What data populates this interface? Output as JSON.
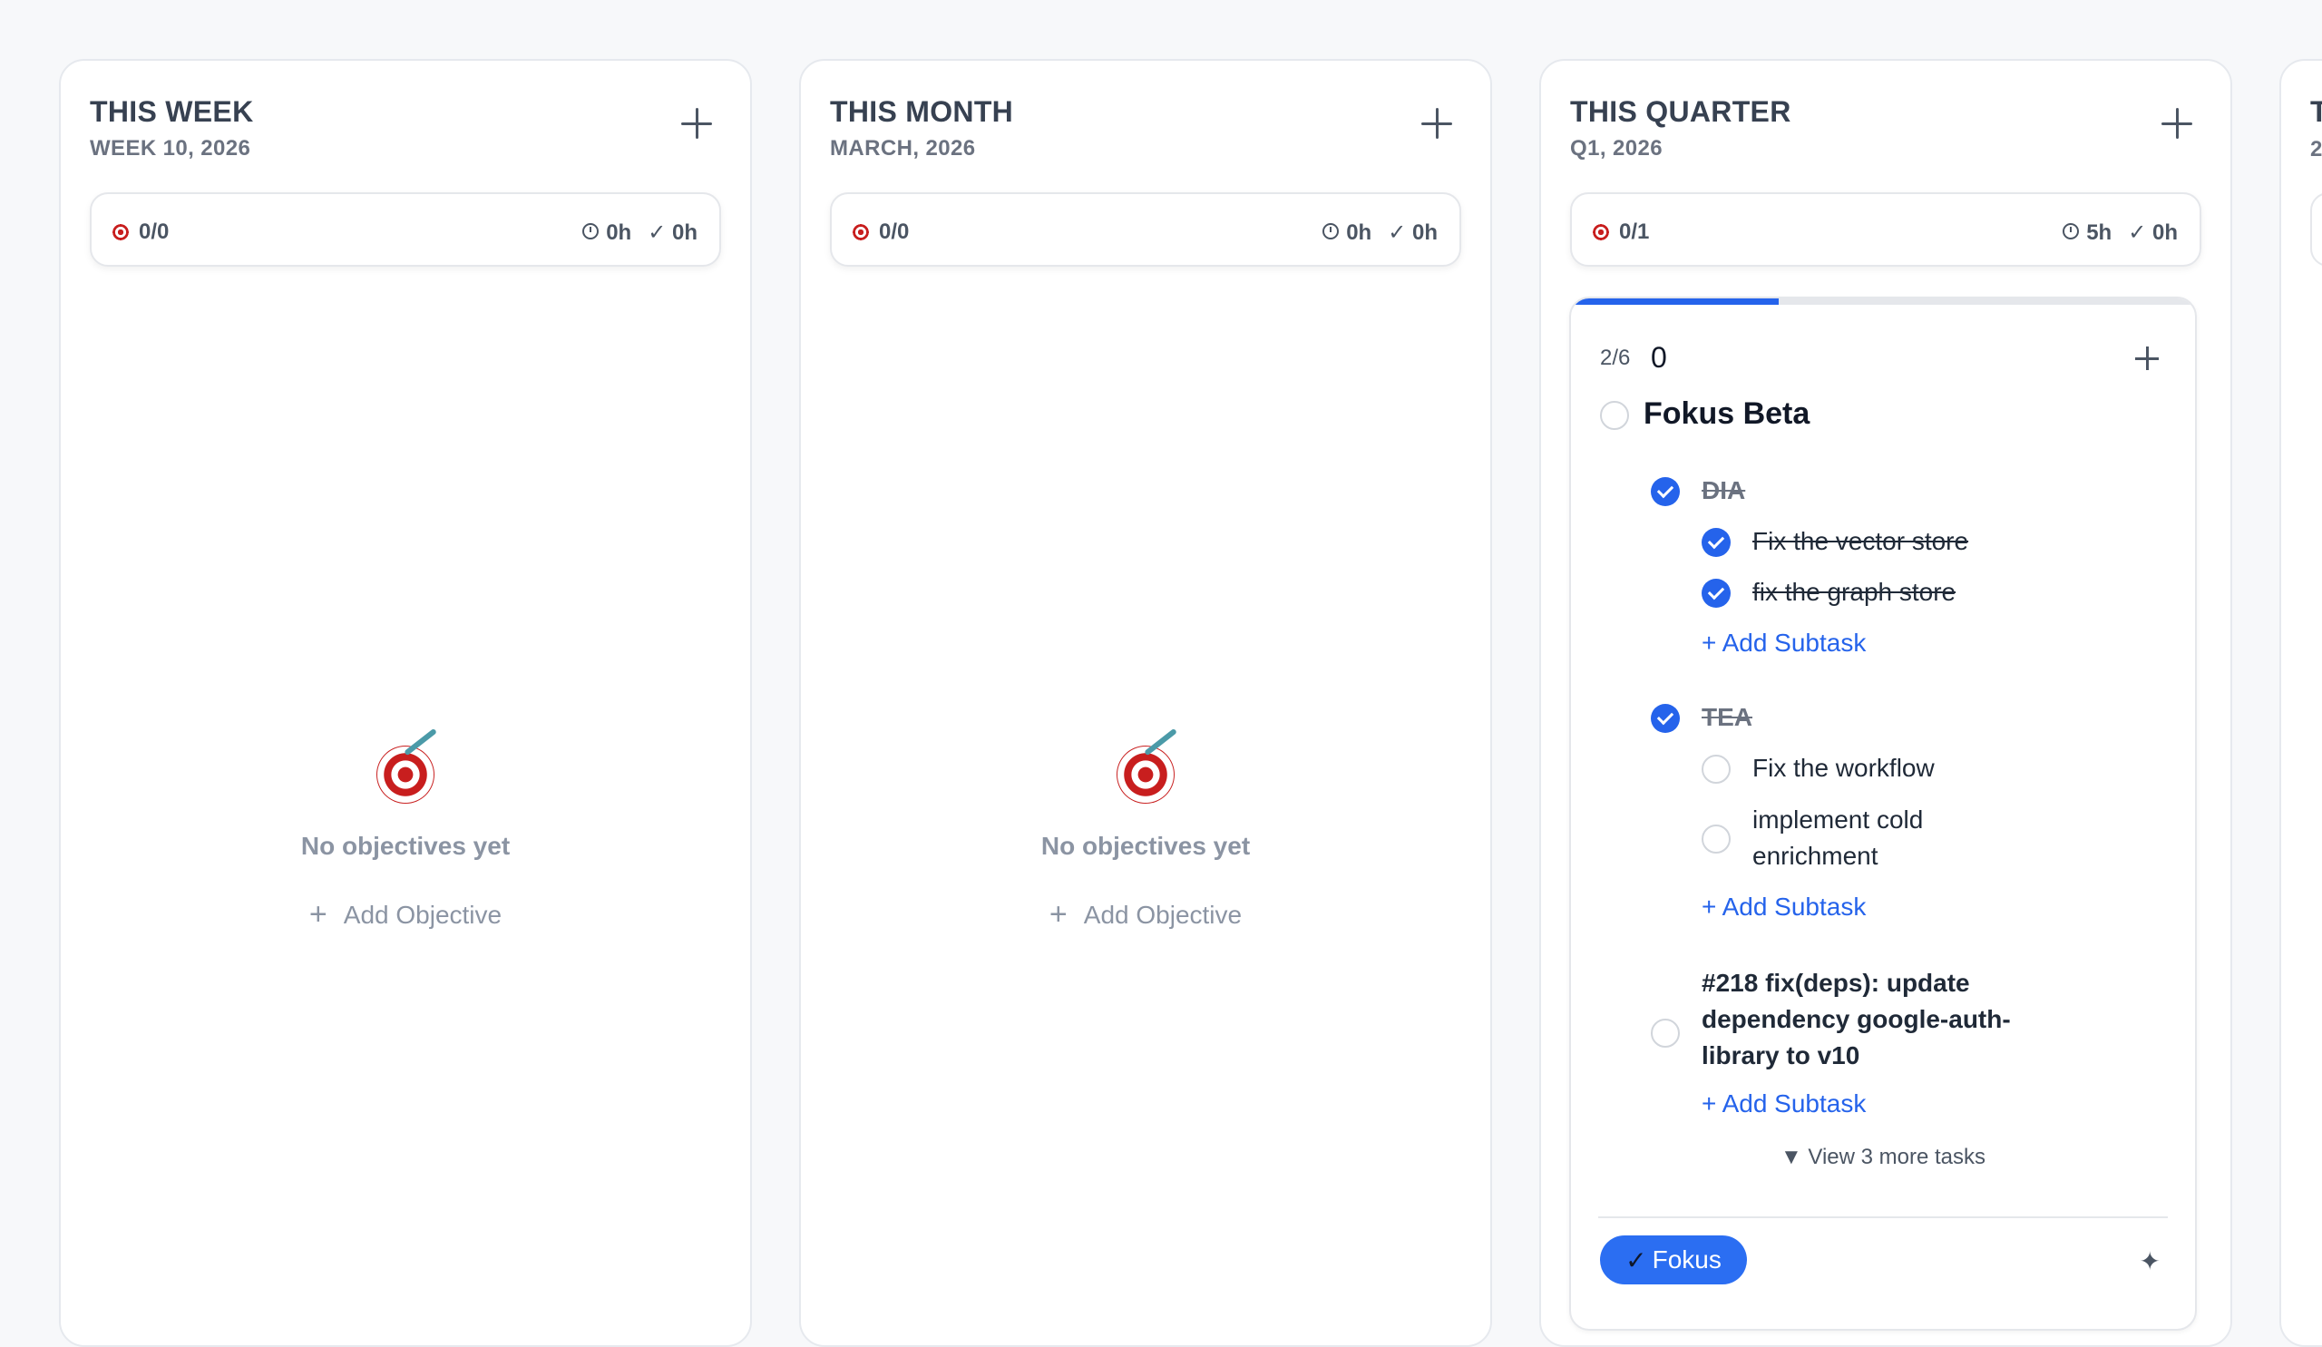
{
  "columns": [
    {
      "title": "THIS WEEK",
      "subtitle": "WEEK 10, 2026",
      "stats": {
        "objectives": "0/0",
        "planned": "0h",
        "done": "0h"
      },
      "empty_text": "No objectives yet",
      "add_label": "Add Objective"
    },
    {
      "title": "THIS MONTH",
      "subtitle": "MARCH, 2026",
      "stats": {
        "objectives": "0/0",
        "planned": "0h",
        "done": "0h"
      },
      "empty_text": "No objectives yet",
      "add_label": "Add Objective"
    },
    {
      "title": "THIS QUARTER",
      "subtitle": "Q1, 2026",
      "stats": {
        "objectives": "0/1",
        "planned": "5h",
        "done": "0h"
      }
    },
    {
      "title": "T",
      "subtitle": "2"
    }
  ],
  "objective": {
    "progress_text": "2/6",
    "progress_fraction": 0.333,
    "count": "0",
    "title": "Fokus Beta",
    "tasks": [
      {
        "label": "DIA",
        "done": true,
        "subtasks": [
          {
            "label": "Fix the vector store",
            "done": true
          },
          {
            "label": "fix the graph store",
            "done": true
          }
        ],
        "add_subtask": "+ Add Subtask"
      },
      {
        "label": "TEA",
        "done": true,
        "subtasks": [
          {
            "label": "Fix the workflow",
            "done": false
          },
          {
            "label": "implement cold enrichment",
            "done": false
          }
        ],
        "add_subtask": "+ Add Subtask"
      },
      {
        "label": "#218 fix(deps): update dependency google-auth-library to v10",
        "done": false,
        "subtasks": [],
        "add_subtask": "+ Add Subtask"
      }
    ],
    "view_more": "▼ View 3 more tasks",
    "fokus_button": "Fokus",
    "fokus_check": "✓"
  },
  "icons": {
    "stats_done": "✓",
    "sparkle": "✦"
  },
  "colors": {
    "accent": "#2563eb"
  }
}
